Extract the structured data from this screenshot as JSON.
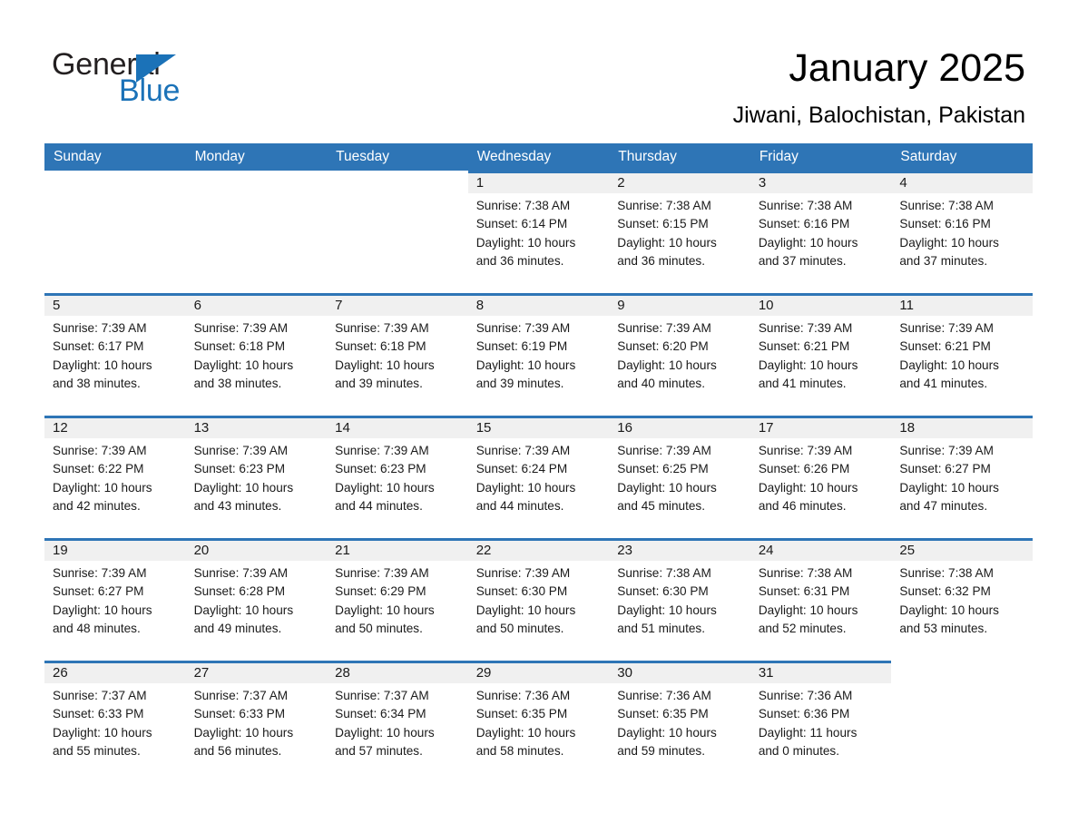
{
  "brand": {
    "line1": "General",
    "line2": "Blue",
    "accent_color": "#1b72b8",
    "triangle_icon": "triangle-icon"
  },
  "header": {
    "title": "January 2025",
    "subtitle": "Jiwani, Balochistan, Pakistan"
  },
  "calendar": {
    "header_color": "#2e75b6",
    "date_band_color": "#f0f0f0",
    "day_names": [
      "Sunday",
      "Monday",
      "Tuesday",
      "Wednesday",
      "Thursday",
      "Friday",
      "Saturday"
    ],
    "weeks": [
      [
        {
          "blank": true
        },
        {
          "blank": true
        },
        {
          "blank": true
        },
        {
          "day": "1",
          "sunrise": "Sunrise: 7:38 AM",
          "sunset": "Sunset: 6:14 PM",
          "daylight_line1": "Daylight: 10 hours",
          "daylight_line2": "and 36 minutes."
        },
        {
          "day": "2",
          "sunrise": "Sunrise: 7:38 AM",
          "sunset": "Sunset: 6:15 PM",
          "daylight_line1": "Daylight: 10 hours",
          "daylight_line2": "and 36 minutes."
        },
        {
          "day": "3",
          "sunrise": "Sunrise: 7:38 AM",
          "sunset": "Sunset: 6:16 PM",
          "daylight_line1": "Daylight: 10 hours",
          "daylight_line2": "and 37 minutes."
        },
        {
          "day": "4",
          "sunrise": "Sunrise: 7:38 AM",
          "sunset": "Sunset: 6:16 PM",
          "daylight_line1": "Daylight: 10 hours",
          "daylight_line2": "and 37 minutes."
        }
      ],
      [
        {
          "day": "5",
          "sunrise": "Sunrise: 7:39 AM",
          "sunset": "Sunset: 6:17 PM",
          "daylight_line1": "Daylight: 10 hours",
          "daylight_line2": "and 38 minutes."
        },
        {
          "day": "6",
          "sunrise": "Sunrise: 7:39 AM",
          "sunset": "Sunset: 6:18 PM",
          "daylight_line1": "Daylight: 10 hours",
          "daylight_line2": "and 38 minutes."
        },
        {
          "day": "7",
          "sunrise": "Sunrise: 7:39 AM",
          "sunset": "Sunset: 6:18 PM",
          "daylight_line1": "Daylight: 10 hours",
          "daylight_line2": "and 39 minutes."
        },
        {
          "day": "8",
          "sunrise": "Sunrise: 7:39 AM",
          "sunset": "Sunset: 6:19 PM",
          "daylight_line1": "Daylight: 10 hours",
          "daylight_line2": "and 39 minutes."
        },
        {
          "day": "9",
          "sunrise": "Sunrise: 7:39 AM",
          "sunset": "Sunset: 6:20 PM",
          "daylight_line1": "Daylight: 10 hours",
          "daylight_line2": "and 40 minutes."
        },
        {
          "day": "10",
          "sunrise": "Sunrise: 7:39 AM",
          "sunset": "Sunset: 6:21 PM",
          "daylight_line1": "Daylight: 10 hours",
          "daylight_line2": "and 41 minutes."
        },
        {
          "day": "11",
          "sunrise": "Sunrise: 7:39 AM",
          "sunset": "Sunset: 6:21 PM",
          "daylight_line1": "Daylight: 10 hours",
          "daylight_line2": "and 41 minutes."
        }
      ],
      [
        {
          "day": "12",
          "sunrise": "Sunrise: 7:39 AM",
          "sunset": "Sunset: 6:22 PM",
          "daylight_line1": "Daylight: 10 hours",
          "daylight_line2": "and 42 minutes."
        },
        {
          "day": "13",
          "sunrise": "Sunrise: 7:39 AM",
          "sunset": "Sunset: 6:23 PM",
          "daylight_line1": "Daylight: 10 hours",
          "daylight_line2": "and 43 minutes."
        },
        {
          "day": "14",
          "sunrise": "Sunrise: 7:39 AM",
          "sunset": "Sunset: 6:23 PM",
          "daylight_line1": "Daylight: 10 hours",
          "daylight_line2": "and 44 minutes."
        },
        {
          "day": "15",
          "sunrise": "Sunrise: 7:39 AM",
          "sunset": "Sunset: 6:24 PM",
          "daylight_line1": "Daylight: 10 hours",
          "daylight_line2": "and 44 minutes."
        },
        {
          "day": "16",
          "sunrise": "Sunrise: 7:39 AM",
          "sunset": "Sunset: 6:25 PM",
          "daylight_line1": "Daylight: 10 hours",
          "daylight_line2": "and 45 minutes."
        },
        {
          "day": "17",
          "sunrise": "Sunrise: 7:39 AM",
          "sunset": "Sunset: 6:26 PM",
          "daylight_line1": "Daylight: 10 hours",
          "daylight_line2": "and 46 minutes."
        },
        {
          "day": "18",
          "sunrise": "Sunrise: 7:39 AM",
          "sunset": "Sunset: 6:27 PM",
          "daylight_line1": "Daylight: 10 hours",
          "daylight_line2": "and 47 minutes."
        }
      ],
      [
        {
          "day": "19",
          "sunrise": "Sunrise: 7:39 AM",
          "sunset": "Sunset: 6:27 PM",
          "daylight_line1": "Daylight: 10 hours",
          "daylight_line2": "and 48 minutes."
        },
        {
          "day": "20",
          "sunrise": "Sunrise: 7:39 AM",
          "sunset": "Sunset: 6:28 PM",
          "daylight_line1": "Daylight: 10 hours",
          "daylight_line2": "and 49 minutes."
        },
        {
          "day": "21",
          "sunrise": "Sunrise: 7:39 AM",
          "sunset": "Sunset: 6:29 PM",
          "daylight_line1": "Daylight: 10 hours",
          "daylight_line2": "and 50 minutes."
        },
        {
          "day": "22",
          "sunrise": "Sunrise: 7:39 AM",
          "sunset": "Sunset: 6:30 PM",
          "daylight_line1": "Daylight: 10 hours",
          "daylight_line2": "and 50 minutes."
        },
        {
          "day": "23",
          "sunrise": "Sunrise: 7:38 AM",
          "sunset": "Sunset: 6:30 PM",
          "daylight_line1": "Daylight: 10 hours",
          "daylight_line2": "and 51 minutes."
        },
        {
          "day": "24",
          "sunrise": "Sunrise: 7:38 AM",
          "sunset": "Sunset: 6:31 PM",
          "daylight_line1": "Daylight: 10 hours",
          "daylight_line2": "and 52 minutes."
        },
        {
          "day": "25",
          "sunrise": "Sunrise: 7:38 AM",
          "sunset": "Sunset: 6:32 PM",
          "daylight_line1": "Daylight: 10 hours",
          "daylight_line2": "and 53 minutes."
        }
      ],
      [
        {
          "day": "26",
          "sunrise": "Sunrise: 7:37 AM",
          "sunset": "Sunset: 6:33 PM",
          "daylight_line1": "Daylight: 10 hours",
          "daylight_line2": "and 55 minutes."
        },
        {
          "day": "27",
          "sunrise": "Sunrise: 7:37 AM",
          "sunset": "Sunset: 6:33 PM",
          "daylight_line1": "Daylight: 10 hours",
          "daylight_line2": "and 56 minutes."
        },
        {
          "day": "28",
          "sunrise": "Sunrise: 7:37 AM",
          "sunset": "Sunset: 6:34 PM",
          "daylight_line1": "Daylight: 10 hours",
          "daylight_line2": "and 57 minutes."
        },
        {
          "day": "29",
          "sunrise": "Sunrise: 7:36 AM",
          "sunset": "Sunset: 6:35 PM",
          "daylight_line1": "Daylight: 10 hours",
          "daylight_line2": "and 58 minutes."
        },
        {
          "day": "30",
          "sunrise": "Sunrise: 7:36 AM",
          "sunset": "Sunset: 6:35 PM",
          "daylight_line1": "Daylight: 10 hours",
          "daylight_line2": "and 59 minutes."
        },
        {
          "day": "31",
          "sunrise": "Sunrise: 7:36 AM",
          "sunset": "Sunset: 6:36 PM",
          "daylight_line1": "Daylight: 11 hours",
          "daylight_line2": "and 0 minutes."
        },
        {
          "blank": true
        }
      ]
    ]
  }
}
